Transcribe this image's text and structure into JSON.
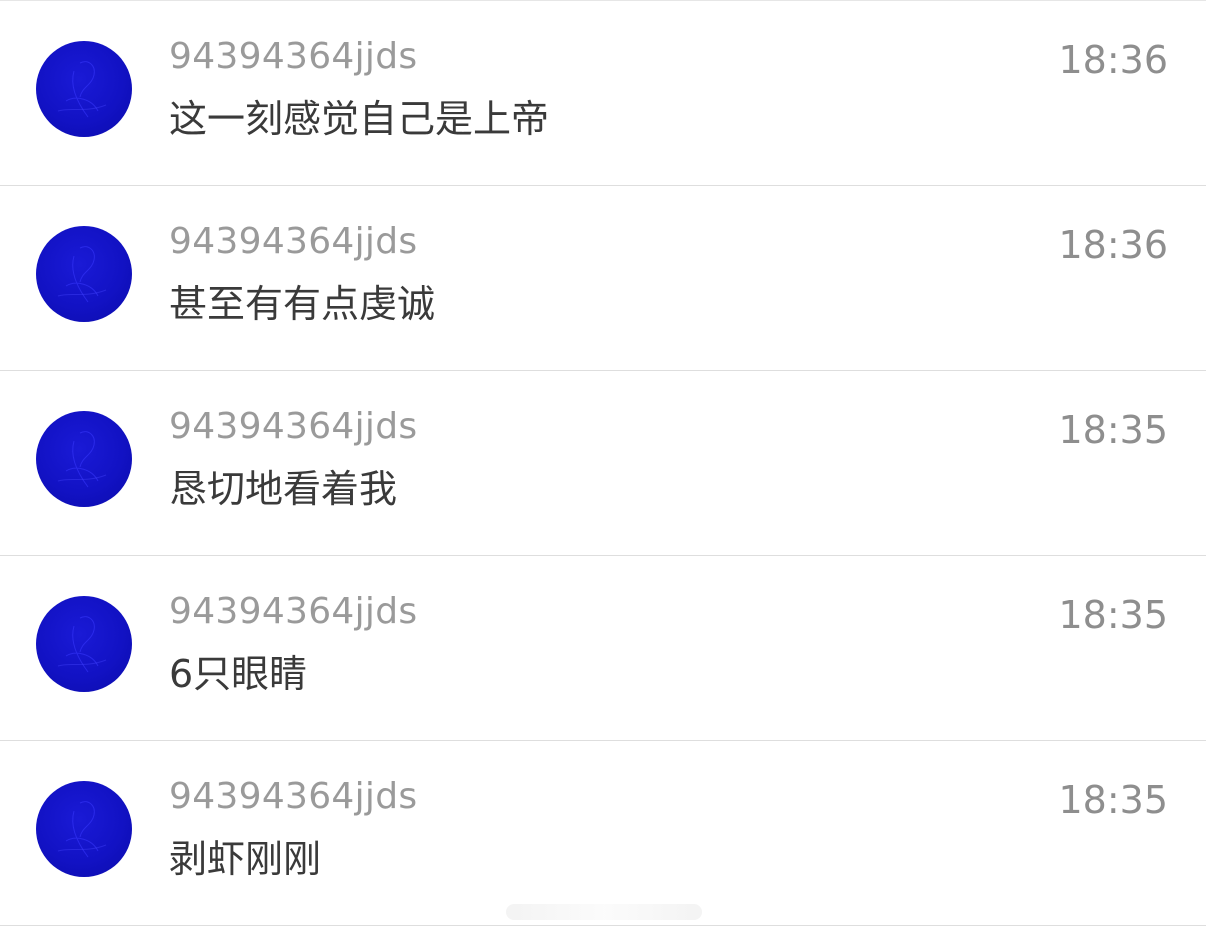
{
  "colors": {
    "avatar": "#1212c4",
    "username": "#9a9a9a",
    "message": "#3a3a3a",
    "time": "#8e8e8e",
    "divider": "#dedede",
    "background": "#ffffff"
  },
  "messages": [
    {
      "avatar_icon": "user-avatar",
      "username": "94394364jjds",
      "text": "这一刻感觉自己是上帝",
      "time": "18:36"
    },
    {
      "avatar_icon": "user-avatar",
      "username": "94394364jjds",
      "text": "甚至有有点虔诚",
      "time": "18:36"
    },
    {
      "avatar_icon": "user-avatar",
      "username": "94394364jjds",
      "text": "恳切地看着我",
      "time": "18:35"
    },
    {
      "avatar_icon": "user-avatar",
      "username": "94394364jjds",
      "text": "6只眼睛",
      "time": "18:35"
    },
    {
      "avatar_icon": "user-avatar",
      "username": "94394364jjds",
      "text": "剥虾刚刚",
      "time": "18:35"
    }
  ]
}
